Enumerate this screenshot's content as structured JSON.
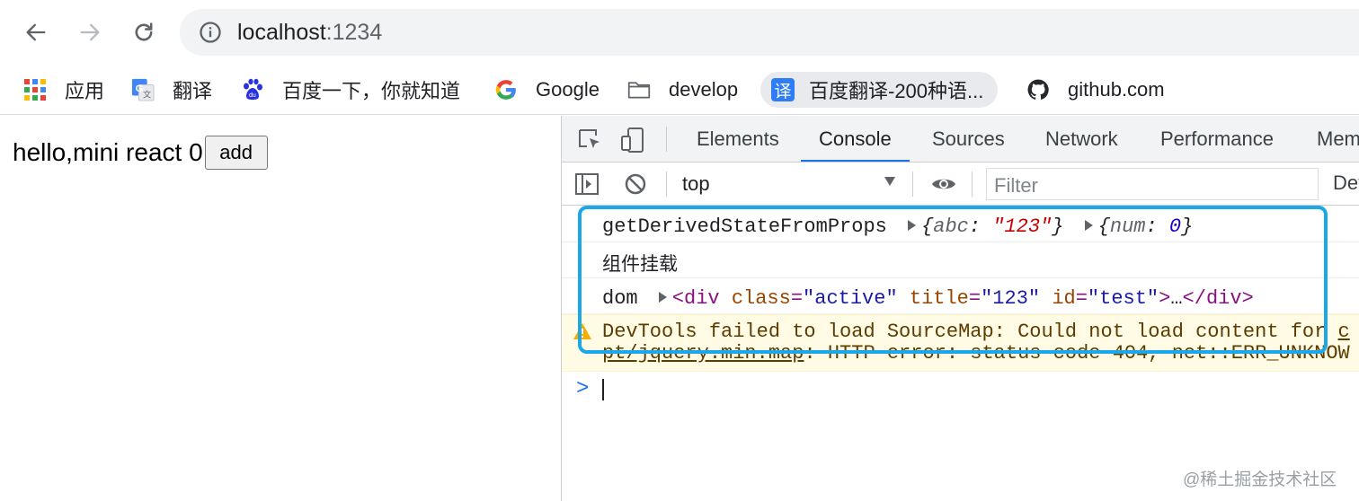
{
  "browser": {
    "url_host": "localhost",
    "url_port": ":1234"
  },
  "bookmarks": [
    {
      "label": "应用",
      "icon": "apps-grid-icon"
    },
    {
      "label": "翻译",
      "icon": "google-translate-icon"
    },
    {
      "label": "百度一下，你就知道",
      "icon": "baidu-paw-icon"
    },
    {
      "label": "Google",
      "icon": "google-g-icon"
    },
    {
      "label": "develop",
      "icon": "folder-icon"
    },
    {
      "label": "百度翻译-200种语...",
      "icon": "baidu-translate-icon",
      "icon_text": "译"
    },
    {
      "label": "github.com",
      "icon": "github-icon"
    }
  ],
  "page": {
    "text": "hello,mini react 0",
    "button": "add"
  },
  "devtools": {
    "tabs": [
      "Elements",
      "Console",
      "Sources",
      "Network",
      "Performance",
      "Mem"
    ],
    "selected_tab": "Console",
    "context": "top",
    "filter_placeholder": "Filter",
    "default_levels": "Def",
    "console": {
      "line1": {
        "label": "getDerivedStateFromProps",
        "obj1": {
          "open": "{",
          "key": "abc",
          "sep": ": ",
          "value": "\"123\"",
          "close": "}"
        },
        "obj2": {
          "open": "{",
          "key": "num",
          "sep": ": ",
          "value": "0",
          "close": "}"
        }
      },
      "line2": "组件挂载",
      "line3": {
        "label": "dom",
        "lt": "<",
        "tag": "div",
        "a1": "class",
        "v1": "\"active\"",
        "a2": "title",
        "v2": "\"123\"",
        "a3": "id",
        "v3": "\"test\"",
        "gt": ">",
        "ellipsis": "…",
        "close": "</div>"
      },
      "warning": {
        "line1_text": "DevTools failed to load SourceMap: Could not load content for ",
        "line1_link": "c",
        "line2_link": "pt/jquery.min.map",
        "line2_text": ": HTTP error: status code 404, net::ERR_UNKNOW"
      },
      "prompt": ">"
    }
  },
  "watermark": "@稀土掘金技术社区",
  "colors": {
    "highlight": "#1ba8e8",
    "tab_underline": "#1a73e8",
    "warning_bg": "#fffbe5"
  }
}
